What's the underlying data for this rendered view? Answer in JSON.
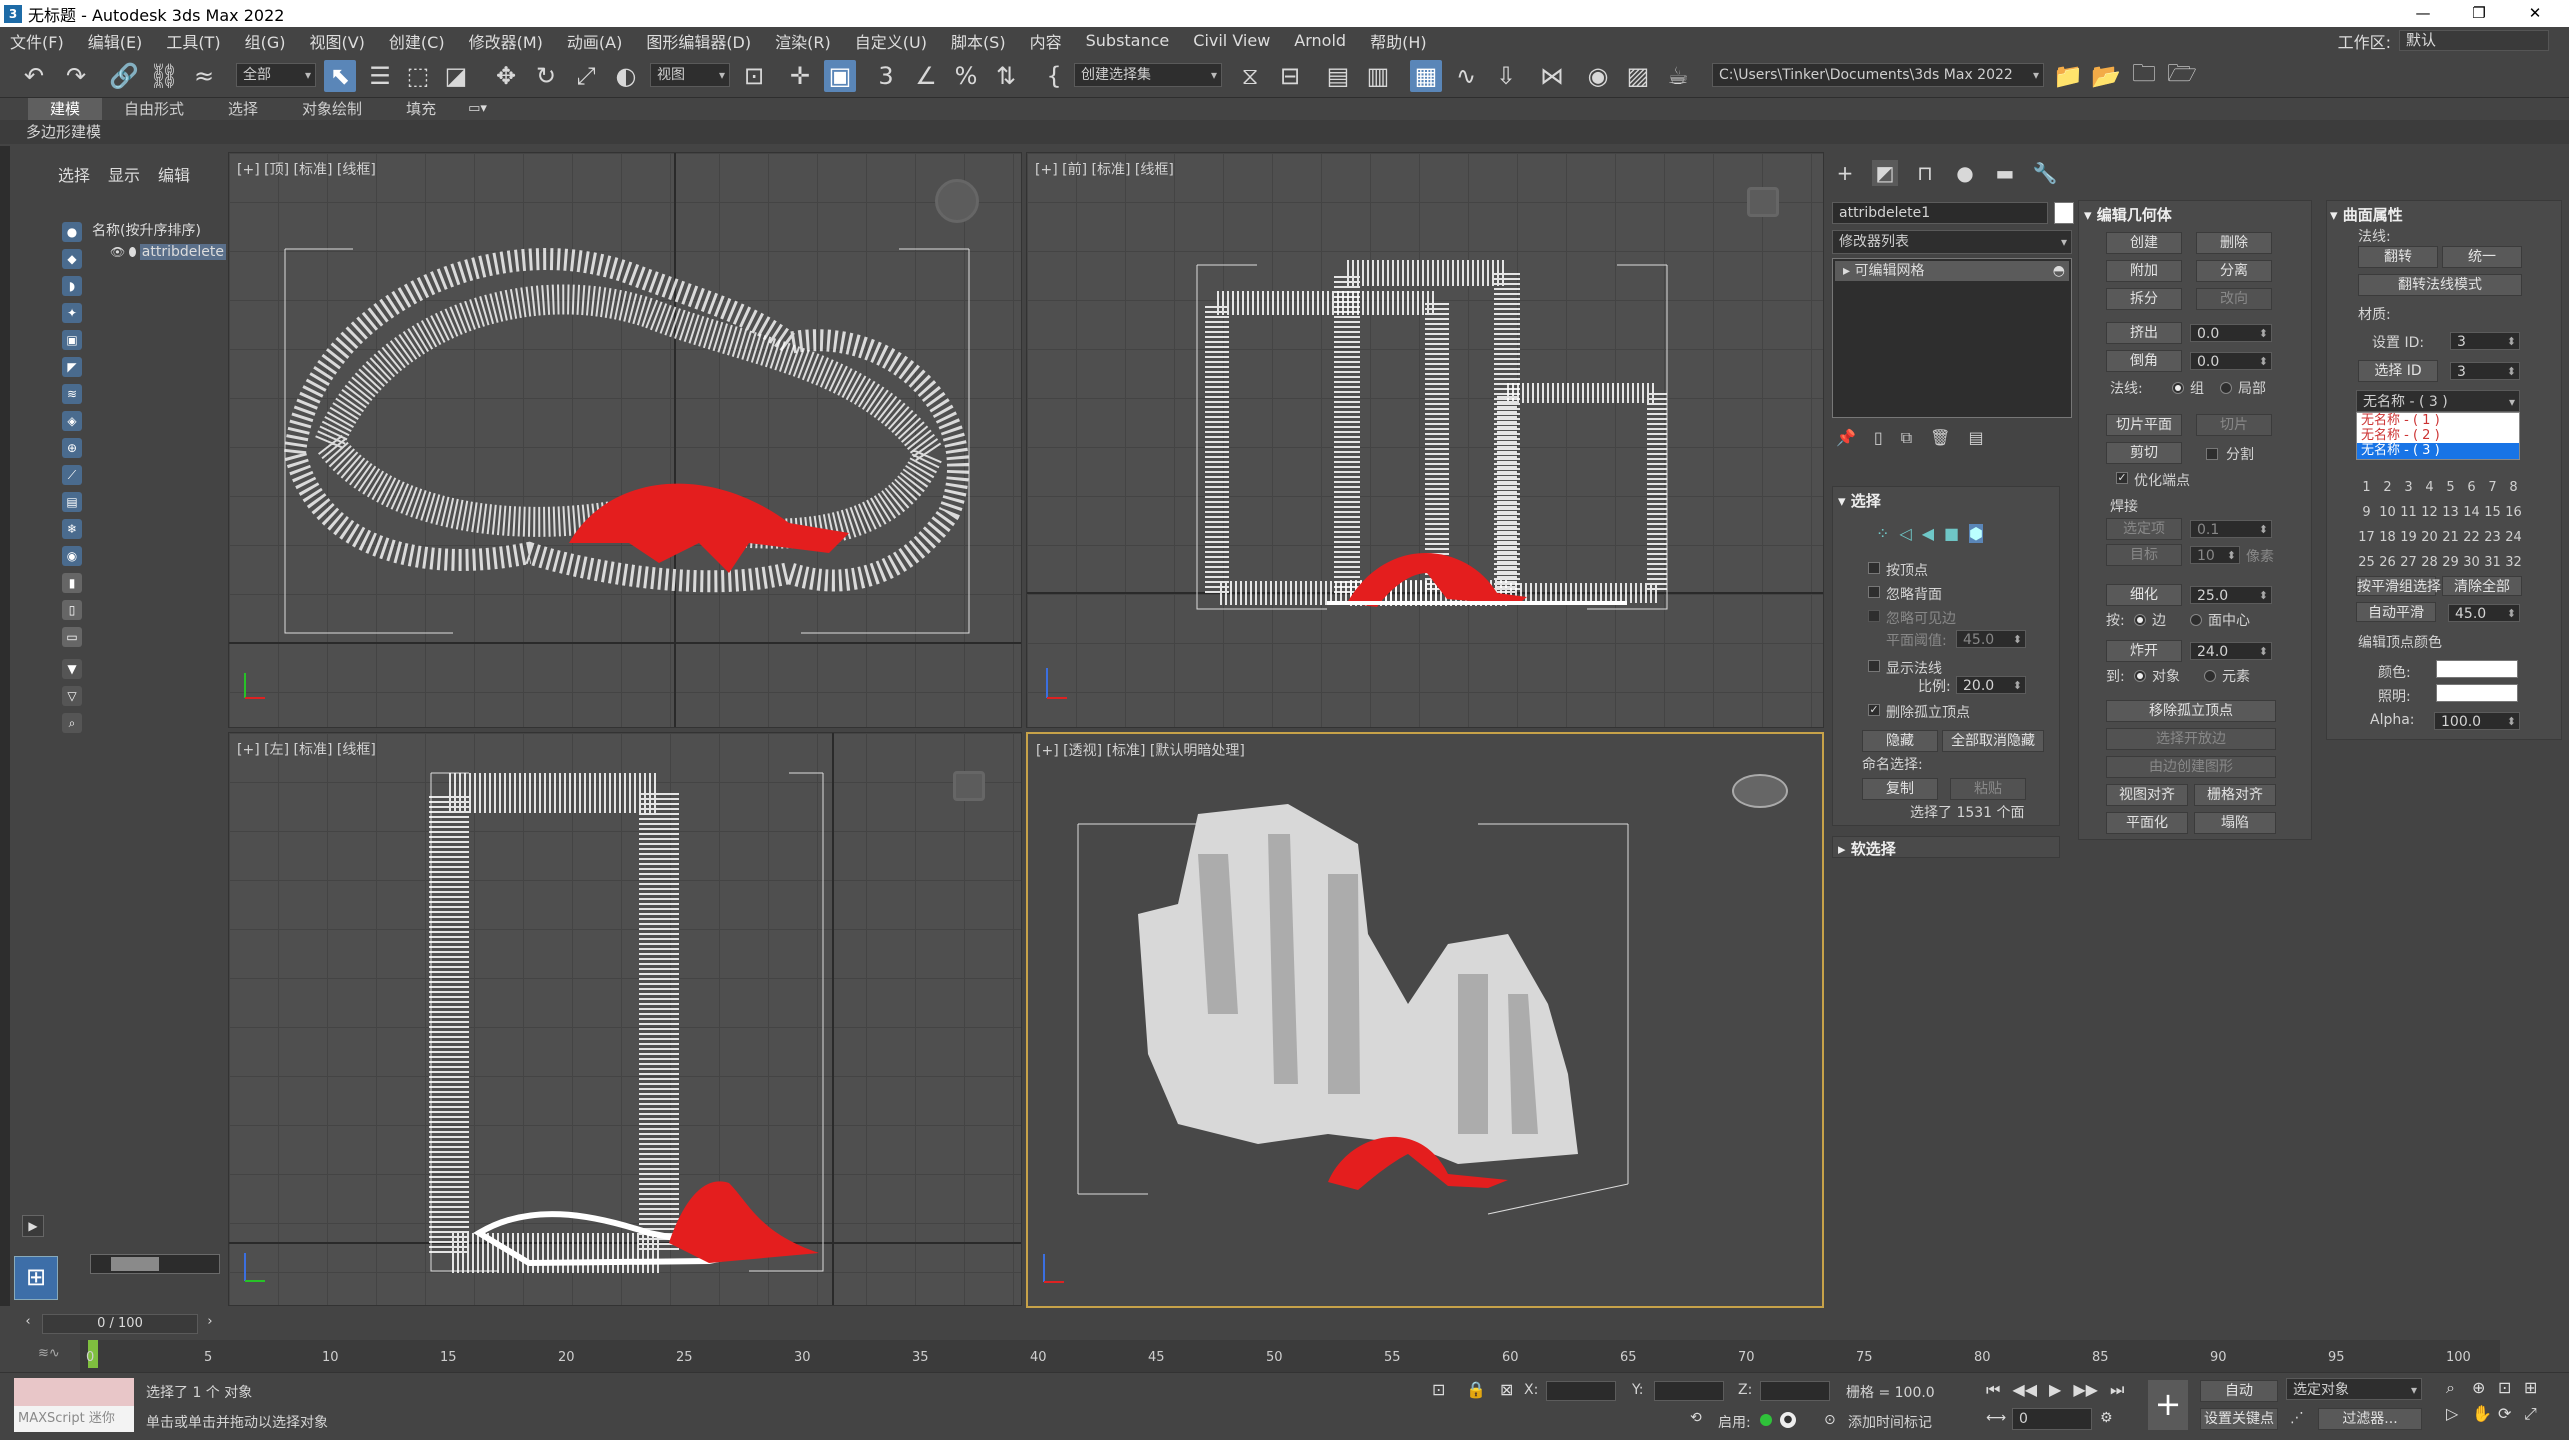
{
  "window": {
    "title": "无标题 - Autodesk 3ds Max 2022",
    "icon": "3"
  },
  "menu": [
    "文件(F)",
    "编辑(E)",
    "工具(T)",
    "组(G)",
    "视图(V)",
    "创建(C)",
    "修改器(M)",
    "动画(A)",
    "图形编辑器(D)",
    "渲染(R)",
    "自定义(U)",
    "脚本(S)",
    "内容",
    "Substance",
    "Civil View",
    "Arnold",
    "帮助(H)"
  ],
  "workspace": {
    "label": "工作区:",
    "value": "默认"
  },
  "toolbar": {
    "filter": "全部",
    "refcoord": "视图",
    "named_sel": "创建选择集",
    "path": "C:\\Users\\Tinker\\Documents\\3ds Max 2022"
  },
  "ribbon": {
    "tabs": [
      "建模",
      "自由形式",
      "选择",
      "对象绘制",
      "填充"
    ],
    "sub": "多边形建模"
  },
  "explorer": {
    "tabs": [
      "选择",
      "显示",
      "编辑"
    ],
    "header": "名称(按升序排序)",
    "item": "attribdelete"
  },
  "viewports": {
    "top": "[+] [顶] [标准] [线框]",
    "front": "[+] [前] [标准] [线框]",
    "left": "[+] [左] [标准] [线框]",
    "persp": "[+] [透视] [标准] [默认明暗处理]"
  },
  "cmd": {
    "object_name": "attribdelete1",
    "modifier_list": "修改器列表",
    "stack_item": "可编辑网格",
    "selection": {
      "title": "选择",
      "by_vertex": "按顶点",
      "ignore_back": "忽略背面",
      "ignore_visible": "忽略可见边",
      "planar_thresh": "平面阈值:",
      "planar_val": "45.0",
      "show_normals": "显示法线",
      "scale": "比例:",
      "scale_val": "20.0",
      "del_isolated": "删除孤立顶点",
      "hide": "隐藏",
      "unhide_all": "全部取消隐藏",
      "named_sel": "命名选择:",
      "copy": "复制",
      "paste": "粘贴",
      "count": "选择了 1531 个面"
    },
    "soft_sel": "软选择",
    "edit_geom": {
      "title": "编辑几何体",
      "create": "创建",
      "delete": "删除",
      "attach": "附加",
      "detach": "分离",
      "split": "拆分",
      "turn": "改向",
      "extrude": "挤出",
      "extrude_val": "0.0",
      "bevel": "倒角",
      "bevel_val": "0.0",
      "normal": "法线:",
      "group": "组",
      "local": "局部",
      "slice_plane": "切片平面",
      "slice": "切片",
      "cut": "剪切",
      "split2": "分割",
      "refine_ends": "优化端点",
      "weld": "焊接",
      "selected": "选定项",
      "selected_val": "0.1",
      "target": "目标",
      "target_val": "10",
      "pixels": "像素",
      "tessellate": "细化",
      "tess_val": "25.0",
      "by": "按:",
      "edge": "边",
      "face_center": "面中心",
      "explode": "炸开",
      "explode_val": "24.0",
      "to": "到:",
      "object": "对象",
      "element": "元素",
      "remove_iso": "移除孤立顶点",
      "sel_open": "选择开放边",
      "create_shape": "由边创建图形",
      "view_align": "视图对齐",
      "grid_align": "栅格对齐",
      "make_planar": "平面化",
      "collapse": "塌陷"
    },
    "surface": {
      "title": "曲面属性",
      "normals": "法线:",
      "flip": "翻转",
      "unify": "统一",
      "flip_mode": "翻转法线模式",
      "material": "材质:",
      "set_id": "设置 ID:",
      "set_id_val": "3",
      "select_id": "选择 ID",
      "select_id_val": "3",
      "mat_dropdown": "无名称 - ( 3 )",
      "mat_options": [
        "无名称 - ( 1 )",
        "无名称 - ( 2 )",
        "无名称 - ( 3 )"
      ],
      "smoothing_groups": [
        "1",
        "2",
        "3",
        "4",
        "5",
        "6",
        "7",
        "8",
        "9",
        "10",
        "11",
        "12",
        "13",
        "14",
        "15",
        "16",
        "17",
        "18",
        "19",
        "20",
        "21",
        "22",
        "23",
        "24",
        "25",
        "26",
        "27",
        "28",
        "29",
        "30",
        "31",
        "32"
      ],
      "select_by_sg": "按平滑组选择",
      "clear_all": "清除全部",
      "auto_smooth": "自动平滑",
      "auto_smooth_val": "45.0",
      "vert_colors": "编辑顶点颜色",
      "color": "颜色:",
      "illum": "照明:",
      "alpha": "Alpha:",
      "alpha_val": "100.0"
    }
  },
  "timeline": {
    "frame": "0 / 100",
    "ticks": [
      "0",
      "5",
      "10",
      "15",
      "20",
      "25",
      "30",
      "35",
      "40",
      "45",
      "50",
      "55",
      "60",
      "65",
      "70",
      "75",
      "80",
      "85",
      "90",
      "95",
      "100"
    ]
  },
  "status": {
    "maxscript": "MAXScript 迷你",
    "selected": "选择了 1 个 对象",
    "prompt": "单击或单击并拖动以选择对象",
    "x": "X:",
    "y": "Y:",
    "z": "Z:",
    "grid": "栅格 = 100.0",
    "enable": "启用:",
    "add_tag": "添加时间标记",
    "auto": "自动",
    "sel_obj": "选定对象",
    "set_key": "设置关键点",
    "filters": "过滤器...",
    "frame_field": "0"
  },
  "colors": {
    "accent": "#5a86b8",
    "selection_red": "#e41e1e",
    "wire": "#ffffff",
    "persp_border": "#c7a249"
  }
}
